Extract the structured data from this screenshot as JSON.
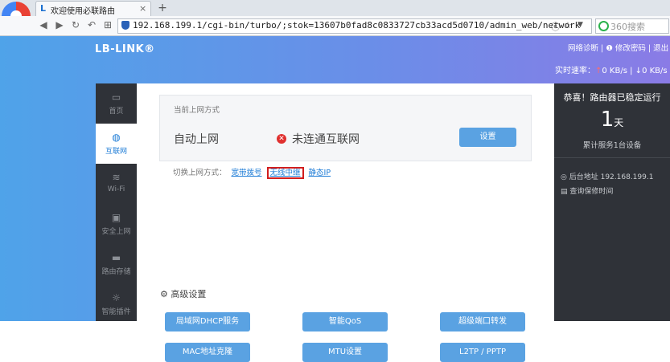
{
  "browser": {
    "tab_title": "欢迎使用必联路由",
    "tab_close": "×",
    "new_tab": "+",
    "url": "192.168.199.1/cgi-bin/turbo/;stok=13607b0fad8c0833727cb33acd5d0710/admin_web/network",
    "search_placeholder": "360搜索"
  },
  "header": {
    "brand": "LB-LINK®",
    "links": [
      "网络诊断",
      "修改密码",
      "退出"
    ],
    "rate_label": "实时速率：",
    "upload": "0 KB/s",
    "download": "0 KB/s"
  },
  "sidebar": {
    "items": [
      {
        "label": "首页",
        "icon": "monitor-icon"
      },
      {
        "label": "互联网",
        "icon": "globe-icon"
      },
      {
        "label": "Wi-Fi",
        "icon": "wifi-icon"
      },
      {
        "label": "安全上网",
        "icon": "lock-icon"
      },
      {
        "label": "路由存储",
        "icon": "folder-icon"
      },
      {
        "label": "智能插件",
        "icon": "sun-icon"
      }
    ]
  },
  "network": {
    "section_title": "当前上网方式",
    "mode": "自动上网",
    "status": "未连通互联网",
    "setup_button": "设置",
    "switch_label": "切换上网方式：",
    "switch_options": [
      "宽带拨号",
      "无线中继",
      "静态IP"
    ]
  },
  "advanced": {
    "title": "高级设置",
    "buttons": [
      "局域网DHCP服务",
      "智能QoS",
      "超级端口转发",
      "MAC地址克隆",
      "MTU设置",
      "L2TP / PPTP"
    ]
  },
  "right_panel": {
    "congrats": "恭喜！路由器已稳定运行",
    "days": "1",
    "days_unit": "天",
    "served": "累计服务1台设备",
    "backend_address": "后台地址 192.168.199.1",
    "warranty": "查询保修时间"
  },
  "colors": {
    "accent": "#5aa2e2",
    "sidebar_bg": "#2f3238",
    "error": "#e0302f",
    "highlight_box": "#d21e1e"
  }
}
